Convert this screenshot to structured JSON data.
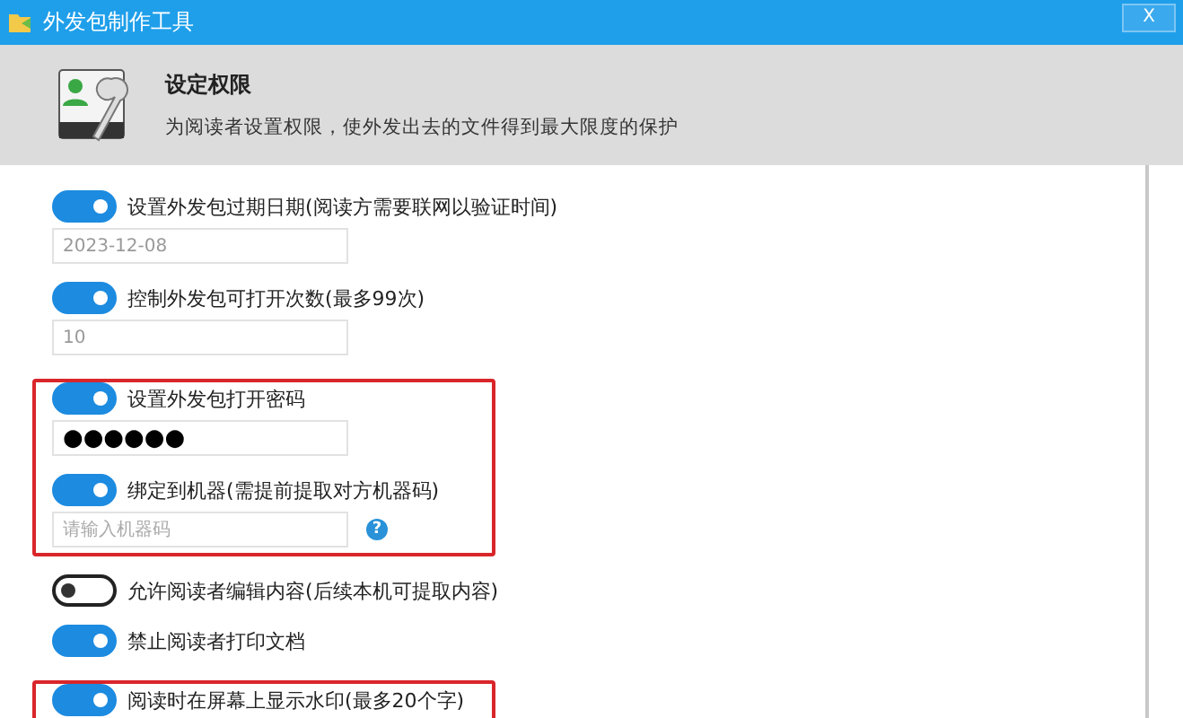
{
  "window": {
    "title": "外发包制作工具",
    "close": "X"
  },
  "header": {
    "title": "设定权限",
    "subtitle": "为阅读者设置权限，使外发出去的文件得到最大限度的保护"
  },
  "sections": [
    {
      "highlighted": false,
      "options": [
        {
          "label": "设置外发包过期日期(阅读方需要联网以验证时间)",
          "on": true,
          "field": {
            "value": "2023-12-08",
            "muted": true
          }
        },
        {
          "label": "控制外发包可打开次数(最多99次)",
          "on": true,
          "field": {
            "value": "10",
            "muted": true
          }
        }
      ]
    },
    {
      "highlighted": true,
      "options": [
        {
          "label": "设置外发包打开密码",
          "on": true,
          "field": {
            "value": "●●●●●●",
            "muted": false
          }
        },
        {
          "label": "绑定到机器(需提前提取对方机器码)",
          "on": true,
          "field": {
            "placeholder": "请输入机器码"
          },
          "help": "?"
        }
      ]
    },
    {
      "highlighted": false,
      "options": [
        {
          "label": "允许阅读者编辑内容(后续本机可提取内容)",
          "on": false
        },
        {
          "label": "禁止阅读者打印文档",
          "on": true
        }
      ]
    },
    {
      "highlighted": true,
      "options": [
        {
          "label": "阅读时在屏幕上显示水印(最多20个字)",
          "on": true
        }
      ]
    }
  ]
}
